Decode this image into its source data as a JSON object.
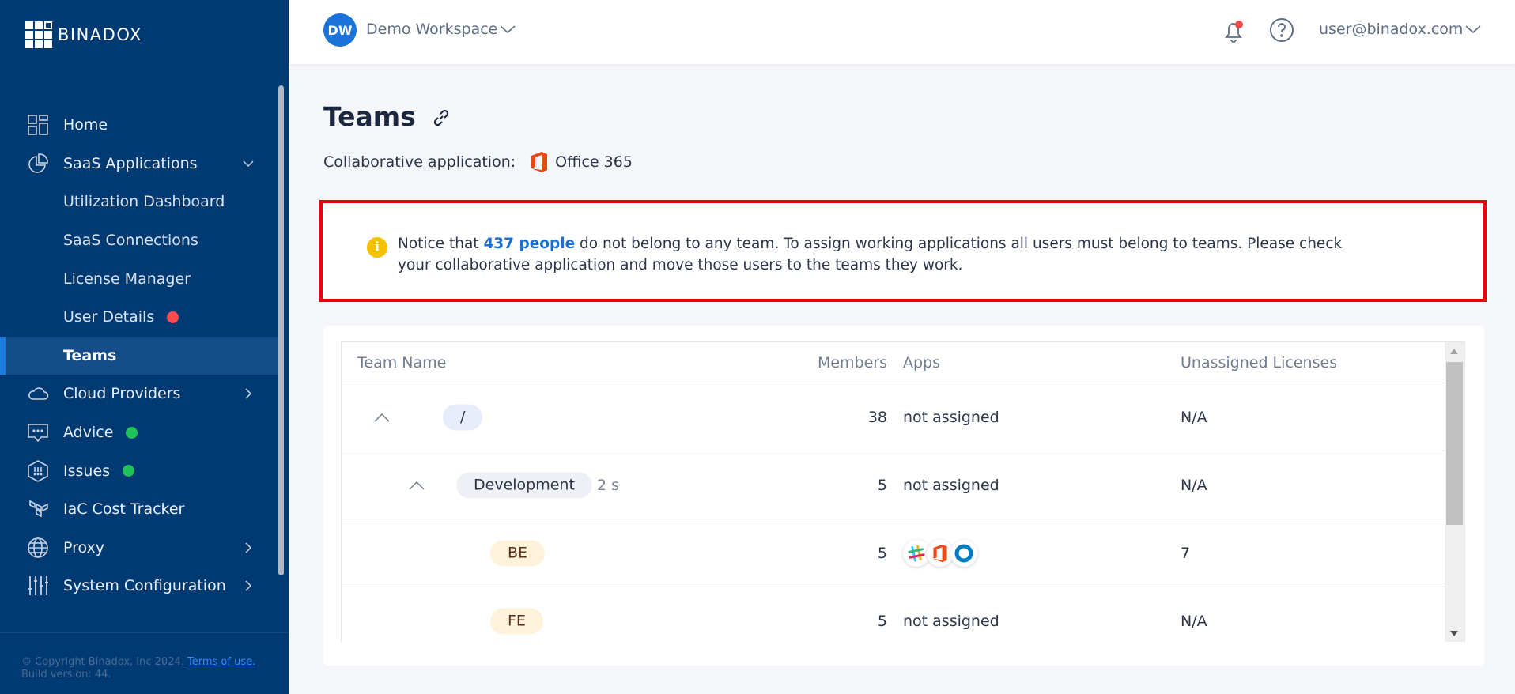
{
  "brand": {
    "name": "BINADOX"
  },
  "sidebar": {
    "items": [
      {
        "label": "Home",
        "icon": "home-grid-icon"
      },
      {
        "label": "SaaS Applications",
        "icon": "pie-chart-icon",
        "expanded": true
      },
      {
        "label": "Utilization Dashboard"
      },
      {
        "label": "SaaS Connections"
      },
      {
        "label": "License Manager"
      },
      {
        "label": "User Details",
        "badge": "red"
      },
      {
        "label": "Teams",
        "active": true
      },
      {
        "label": "Cloud Providers",
        "icon": "cloud-icon"
      },
      {
        "label": "Advice",
        "icon": "chat-icon",
        "badge": "green"
      },
      {
        "label": "Issues",
        "icon": "hexagon-alert-icon",
        "badge": "green"
      },
      {
        "label": "IaC Cost Tracker",
        "icon": "terraform-icon"
      },
      {
        "label": "Proxy",
        "icon": "globe-icon"
      },
      {
        "label": "System Configuration",
        "icon": "sliders-icon"
      }
    ],
    "footer": {
      "copyright": "© Copyright Binadox, Inc 2024. ",
      "terms": "Terms of use.",
      "build": "Build version: 44."
    }
  },
  "topbar": {
    "workspace_initials": "DW",
    "workspace_name": "Demo Workspace",
    "user_email": "user@binadox.com"
  },
  "page": {
    "title": "Teams",
    "collab_label": "Collaborative application:",
    "collab_app": "Office 365"
  },
  "notice": {
    "prefix": "Notice that ",
    "highlight": "437 people",
    "suffix": " do not belong to any team. To assign working applications all users must belong to teams. Please check your collaborative application and move those users to the teams they work."
  },
  "table": {
    "columns": [
      "Team Name",
      "Members",
      "Apps",
      "Unassigned Licenses"
    ],
    "rows": [
      {
        "name": "/",
        "subcount": "",
        "members": "38",
        "apps": "not assigned",
        "unassigned": "N/A"
      },
      {
        "name": "Development",
        "subcount": "2 s",
        "members": "5",
        "apps": "not assigned",
        "unassigned": "N/A"
      },
      {
        "name": "BE",
        "subcount": "",
        "members": "5",
        "apps": "",
        "app_icons": [
          "slack-icon",
          "office365-icon",
          "okta-icon"
        ],
        "unassigned": "7"
      },
      {
        "name": "FE",
        "subcount": "",
        "members": "5",
        "apps": "not assigned",
        "unassigned": "N/A"
      }
    ]
  },
  "colors": {
    "sidebar_bg": "#003a73",
    "accent": "#1a73d9",
    "notice_border": "#f00000",
    "badge_red": "#ff4b4b",
    "badge_green": "#20c35a"
  }
}
